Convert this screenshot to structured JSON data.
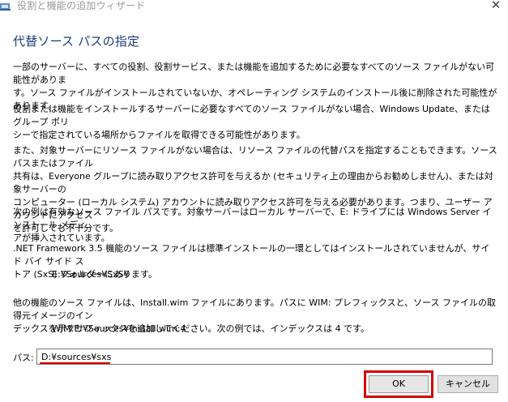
{
  "window": {
    "title": "役割と機能の追加ウィザード",
    "close_glyph": "✕"
  },
  "page": {
    "heading": "代替ソース パスの指定",
    "paragraphs": [
      "一部のサーバーに、すべての役割、役割サービス、または機能を追加するために必要なすべてのソース ファイルがない可能性がありま\nす。ソース ファイルがインストールされていないか、オペレーティング システムのインストール後に削除された可能性があります。",
      "役割または機能をインストールするサーバーに必要なすべてのソース ファイルがない場合、Windows Update、またはグループ ポリ\nシーで指定されている場所からファイルを取得できる可能性があります。",
      "また、対象サーバーにリソース ファイルがない場合は、リソース ファイルの代替パスを指定することもできます。ソース パスまたはファイル\n共有は、Everyone グループに読み取りアクセス許可を与えるか (セキュリティ上の理由からお勧めしません)、または対象サーバーの\nコンピューター (ローカル システム) アカウントに読み取りアクセス許可を与える必要があります。つまり、ユーザー アカウントにアクセス\nを許可しても不十分です。",
      "次の例は有効なソース ファイル パスです。対象サーバーはローカル サーバーで、E: ドライブには Windows Server インストール メディ\nアが挿入されています。",
      ".NET Framework 3.5 機能のソース ファイルは標準インストールの一環としてはインストールされていませんが、サイド バイ サイド ス\nトア (SxS) フォルダーにあります。",
      "他の機能のソース ファイルは、Install.wim ファイルにあります。パスに WIM: プレフィックスと、ソース ファイルの取得元イメージのイン\nデックスを示すサフィックスを追加してください。次の例では、インデックスは 4 です。"
    ],
    "example_sxs_path": "E:¥Sources¥SxS¥",
    "example_wim_path": "WIM:E:¥Sources¥Install.wim:4"
  },
  "path_field": {
    "label": "パス:",
    "value": "D:¥sources¥sxs",
    "highlight_color": "#d40000"
  },
  "buttons": {
    "ok_label": "OK",
    "cancel_label": "キャンセル"
  },
  "colors": {
    "heading": "#1e3a7a",
    "highlight": "#d40000"
  },
  "icons": {
    "app": "wizard-app-icon",
    "close": "close-icon"
  }
}
